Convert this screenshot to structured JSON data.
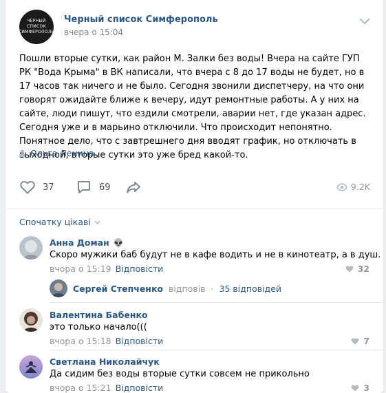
{
  "group": {
    "avatar_line1": "ЧЕРНЫЙ",
    "avatar_line2": "СПИСОК",
    "avatar_line3": "СИМФЕРОПОЛЬ",
    "name": "Черный список Симферополь",
    "time": "вчера о 15:04"
  },
  "post": {
    "text": "Пошли вторые сутки, как район М. Залки без воды! Вчера на сайте ГУП РК \"Вода Крыма\" в ВК написали, что вчера с 8 до 17 воды не будет, но в 17 часов так ничего и не было. Сегодня звонили диспетчеру, на что они говорят ожидайте ближе к вечеру, идут ремонтные работы. А у них на сайте, люди пишут, что ездили смотрели, аварии нет, где указан адрес. Сегодня уже и в марьино отключили. Что происходит непонятно. Понятное дело, что с завтрешнего дня вводят график, но отключать в выходной, вторые сутки это уже бред какой-то.",
    "author": "Ольга Ленина",
    "likes": "37",
    "comments": "69",
    "views": "9.2K"
  },
  "sort": {
    "label": "Спочатку цікаві"
  },
  "comments": [
    {
      "name": "Анна Доман",
      "emoji": "👽",
      "text": "Скоро мужики баб будут не в кафе водить и не в кинотеатр, а в душ.",
      "time": "вчора о 15:19",
      "reply_label": "Відповісти",
      "likes": "32"
    },
    {
      "name": "Валентина Бабенко",
      "text": "это только начало(((",
      "time": "вчора о 15:18",
      "reply_label": "Відповісти",
      "likes": "7"
    },
    {
      "name": "Светлана Николайчук",
      "text": "Да сидим без воды вторые сутки совсем не прикольно",
      "time": "вчора о 15:21",
      "reply_label": "Відповісти",
      "likes": "3"
    }
  ],
  "replies": {
    "name": "Сергей Степченко",
    "action": "відповів",
    "separator": "·",
    "count": "35 відповідей"
  },
  "colors": {
    "link": "#2a5885",
    "meta": "#939699",
    "background": "#edeef0"
  }
}
